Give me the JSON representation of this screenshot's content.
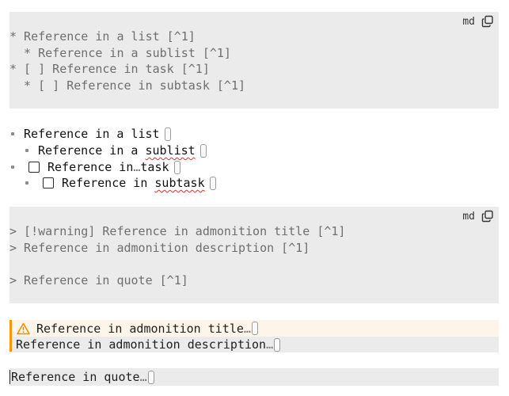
{
  "code_block_1": {
    "lang": "md",
    "lines": [
      "* Reference in a list [^1]",
      "  * Reference in a sublist [^1]",
      "* [ ] Reference in task [^1]",
      "  * [ ] Reference in subtask [^1]"
    ]
  },
  "rendered_list": {
    "item1": "Reference in a list",
    "item2_prefix": "Reference in a ",
    "item2_word": "sublist",
    "item3_a": "Reference in",
    "item3_ellipsis": "…",
    "item3_b": "task",
    "item4_prefix": "Reference in ",
    "item4_word": "subtask"
  },
  "code_block_2": {
    "lang": "md",
    "lines": [
      "> [!warning] Reference in admonition title [^1]",
      "> Reference in admonition description [^1]",
      "",
      "> Reference in quote [^1]"
    ]
  },
  "admonition": {
    "title": "Reference in admonition title",
    "description": "Reference in admonition description",
    "ellipsis": "…",
    "accent_color": "#ff9800",
    "icon": "warning-icon"
  },
  "quote": {
    "text": "Reference in quote",
    "ellipsis": "…"
  }
}
